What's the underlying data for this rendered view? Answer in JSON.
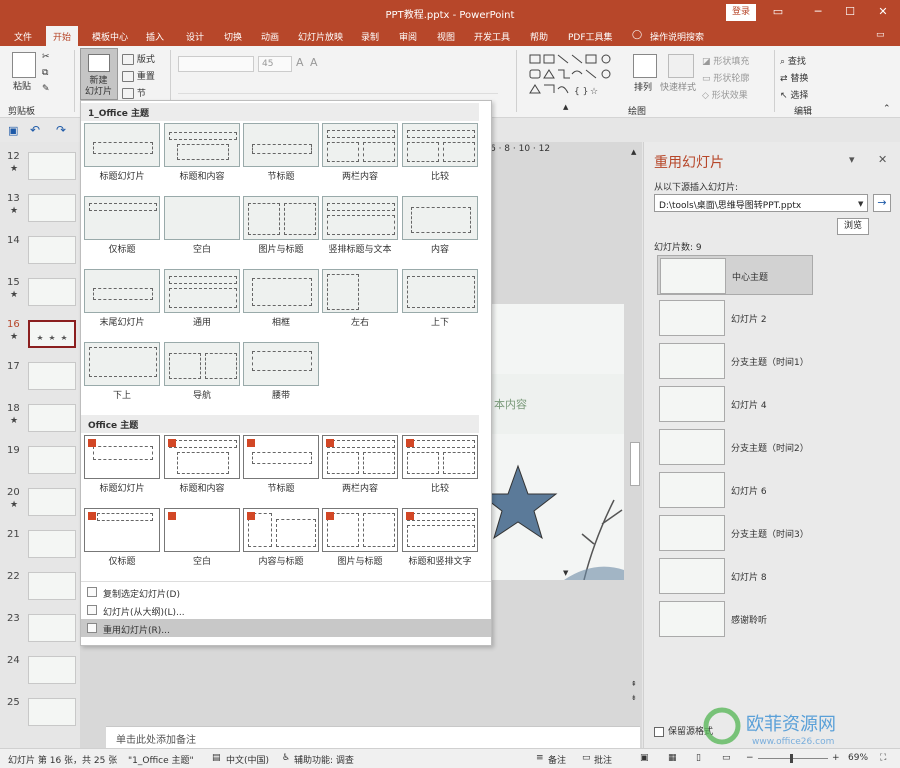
{
  "window": {
    "title": "PPT教程.pptx  -  PowerPoint",
    "login": "登录"
  },
  "tabs": [
    "文件",
    "开始",
    "模板中心",
    "插入",
    "设计",
    "切换",
    "动画",
    "幻灯片放映",
    "录制",
    "审阅",
    "视图",
    "开发工具",
    "帮助",
    "PDF工具集",
    "操作说明搜索"
  ],
  "ribbon": {
    "paste": "粘贴",
    "new_slide": "新建\n幻灯片",
    "layout": "版式",
    "reset": "重置",
    "section": "节",
    "font_size": "45",
    "clipboard": "剪贴板",
    "arrange": "排列",
    "quick_style": "快速样式",
    "shape_fill": "形状填充",
    "shape_outline": "形状轮廓",
    "shape_effect": "形状效果",
    "find": "查找",
    "replace": "替换",
    "select": "选择",
    "drawing": "绘图",
    "editing": "编辑"
  },
  "ruler": "6 · 8 · 10 · 12",
  "thumbs": [
    {
      "n": "12",
      "star": "★"
    },
    {
      "n": "13",
      "star": "★"
    },
    {
      "n": "14",
      "star": ""
    },
    {
      "n": "15",
      "star": "★"
    },
    {
      "n": "16",
      "star": "★"
    },
    {
      "n": "17",
      "star": ""
    },
    {
      "n": "18",
      "star": "★"
    },
    {
      "n": "19",
      "star": ""
    },
    {
      "n": "20",
      "star": "★"
    },
    {
      "n": "21",
      "star": ""
    },
    {
      "n": "22",
      "star": ""
    },
    {
      "n": "23",
      "star": ""
    },
    {
      "n": "24",
      "star": ""
    },
    {
      "n": "25",
      "star": ""
    }
  ],
  "slide": {
    "text": "本内容"
  },
  "dropdown": {
    "section1": "1_Office 主题",
    "layouts1": [
      "标题幻灯片",
      "标题和内容",
      "节标题",
      "两栏内容",
      "比较",
      "仅标题",
      "空白",
      "图片与标题",
      "竖排标题与文本",
      "内容",
      "末尾幻灯片",
      "通用",
      "相框",
      "左右",
      "上下",
      "下上",
      "导航",
      "腰带"
    ],
    "section2": "Office 主题",
    "layouts2": [
      "标题幻灯片",
      "标题和内容",
      "节标题",
      "两栏内容",
      "比较",
      "仅标题",
      "空白",
      "内容与标题",
      "图片与标题",
      "标题和竖排文字"
    ],
    "menu": [
      "复制选定幻灯片(D)",
      "幻灯片(从大纲)(L)...",
      "重用幻灯片(R)..."
    ]
  },
  "notes": "单击此处添加备注",
  "pane": {
    "title": "重用幻灯片",
    "from_label": "从以下源插入幻灯片:",
    "path": "D:\\tools\\桌面\\思维导图转PPT.pptx",
    "browse": "浏览",
    "count": "幻灯片数: 9",
    "items": [
      "中心主题",
      "幻灯片 2",
      "分支主题（时间1）",
      "幻灯片 4",
      "分支主题（时间2）",
      "幻灯片 6",
      "分支主题（时间3）",
      "幻灯片 8",
      "感谢聆听"
    ],
    "keep_format": "保留源格式"
  },
  "status": {
    "slide": "幻灯片 第 16 张，共 25 张",
    "theme": "\"1_Office 主题\"",
    "lang": "中文(中国)",
    "access": "辅助功能: 调查",
    "notes": "备注",
    "comments": "批注",
    "zoom": "69%"
  },
  "watermark": {
    "text": "欧菲资源网",
    "url": "www.office26.com"
  },
  "colors": {
    "accent": "#b7472a",
    "star": "#5b7a99"
  }
}
